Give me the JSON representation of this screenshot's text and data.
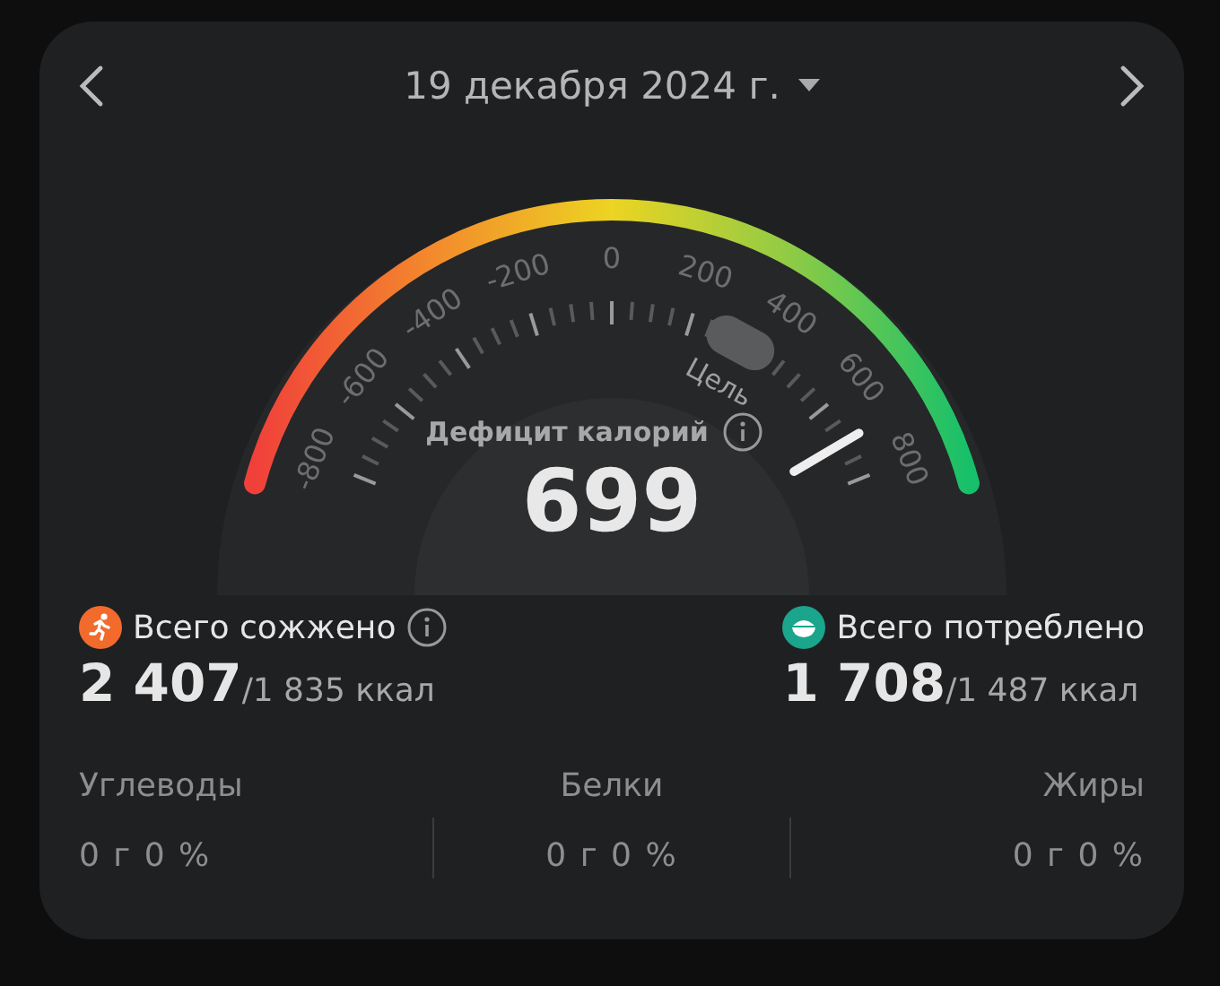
{
  "header": {
    "date": "19 декабря 2024 г."
  },
  "gauge": {
    "scale": [
      "-800",
      "-600",
      "-400",
      "-200",
      "0",
      "200",
      "400",
      "600",
      "800"
    ],
    "goal": {
      "label": "Цель"
    },
    "title": "Дефицит калорий",
    "value": "699"
  },
  "totals": [
    {
      "kind": "burned",
      "title": "Всего сожжено",
      "info": true,
      "value": "2 407",
      "sub": "/1 835 ккал",
      "color": "#f26b2c"
    },
    {
      "kind": "consumed",
      "title": "Всего потреблено",
      "info": false,
      "value": "1 708",
      "sub": "/1 487 ккал",
      "color": "#1aa58c"
    }
  ],
  "macros": [
    {
      "name": "Углеводы",
      "value": "0 г 0 %"
    },
    {
      "name": "Белки",
      "value": "0 г 0 %"
    },
    {
      "name": "Жиры",
      "value": "0 г 0 %"
    }
  ]
}
